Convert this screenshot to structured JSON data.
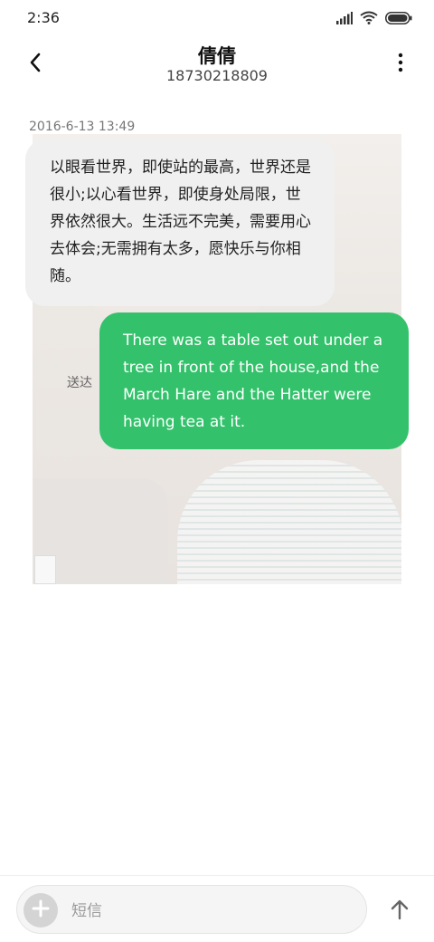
{
  "status_bar": {
    "time": "2:36",
    "icons": [
      "signal-icon",
      "wifi-icon",
      "battery-icon"
    ]
  },
  "header": {
    "contact_name": "倩倩",
    "contact_number": "18730218809",
    "back_icon": "back-chevron-icon",
    "more_icon": "more-vertical-icon"
  },
  "conversation": {
    "timestamp": "2016-6-13 13:49",
    "messages": [
      {
        "direction": "received",
        "text": "以眼看世界，即使站的最高，世界还是很小;以心看世界，即使身处局限，世界依然很大。生活远不完美，需要用心去体会;无需拥有太多，愿快乐与你相随。"
      },
      {
        "direction": "sent",
        "text": "There was a table set out under a tree in front of the house,and the March Hare and the Hatter were having tea at it.",
        "status": "送达"
      }
    ]
  },
  "composer": {
    "placeholder": "短信",
    "add_icon": "plus-icon",
    "send_icon": "arrow-up-icon"
  },
  "colors": {
    "sent_bubble": "#33c26b",
    "received_bubble": "#f0f0f0"
  }
}
